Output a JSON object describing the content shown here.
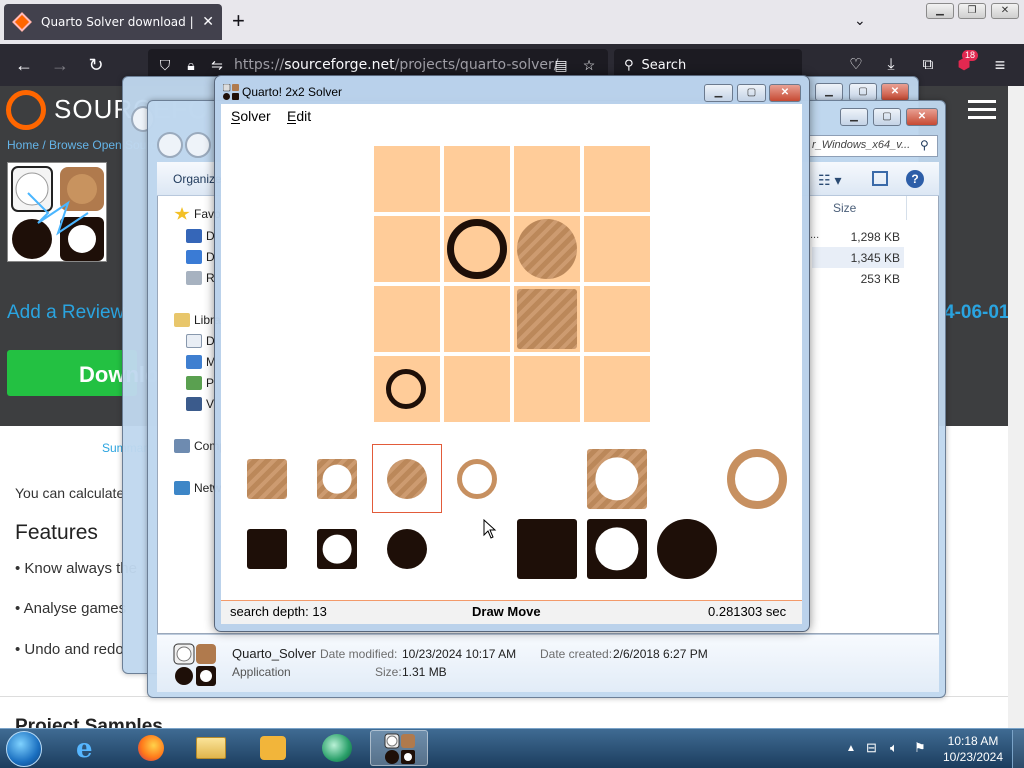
{
  "browser": {
    "tab_title": "Quarto Solver download | SourceForge.net",
    "url_prefix": "https://",
    "url_domain": "sourceforge.net",
    "url_path": "/projects/quarto-solver/",
    "search_placeholder": "Search",
    "extensions_badge": "18"
  },
  "sourceforge": {
    "logo_text": "SOURCEFORGE",
    "breadcrumb": "Home / Browse Open Source",
    "add_review": "Add a Review",
    "date_fragment": "4-06-01",
    "download_label": "Download",
    "summary_link": "Summary",
    "intro_text": "You can calculate",
    "features_heading": "Features",
    "features": [
      "• Know always the",
      "• Analyse games",
      "• Undo and redo"
    ],
    "cut_heading": "Project Samples"
  },
  "explorer": {
    "address": "r_Windows_x64_v...",
    "organize": "Organize",
    "nav": [
      {
        "label": "Favorites",
        "color": "#f3c026"
      },
      {
        "label": "D",
        "color": "#3566b8"
      },
      {
        "label": "D",
        "color": "#3a7bd5"
      },
      {
        "label": "R",
        "color": "#a7b2c0"
      },
      {
        "label": "Libraries",
        "color": "#e8c66b"
      },
      {
        "label": "D",
        "color": "#e9eef5"
      },
      {
        "label": "M",
        "color": "#3f7fd0"
      },
      {
        "label": "P",
        "color": "#5aa050"
      },
      {
        "label": "V",
        "color": "#3b5b8c"
      },
      {
        "label": "Computer",
        "color": "#6e8bb0"
      },
      {
        "label": "Network",
        "color": "#3d86c7"
      }
    ],
    "column_size": "Size",
    "sizes": [
      "1,298 KB",
      "1,345 KB",
      "253 KB"
    ],
    "size_prefix": "...",
    "details": {
      "name": "Quarto_Solver",
      "type": "Application",
      "modified_label": "Date modified:",
      "modified_value": "10/23/2024 10:17 AM",
      "created_label": "Date created:",
      "created_value": "2/6/2018 6:27 PM",
      "size_label": "Size:",
      "size_value": "1.31 MB"
    }
  },
  "solver": {
    "title": "Quarto! 2x2 Solver",
    "menu": [
      "Solver",
      "Edit"
    ],
    "status_depth": "search depth: 13",
    "status_result": "Draw Move",
    "status_time": "0.281303 sec"
  },
  "taskbar": {
    "time": "10:18 AM",
    "date": "10/23/2024"
  }
}
